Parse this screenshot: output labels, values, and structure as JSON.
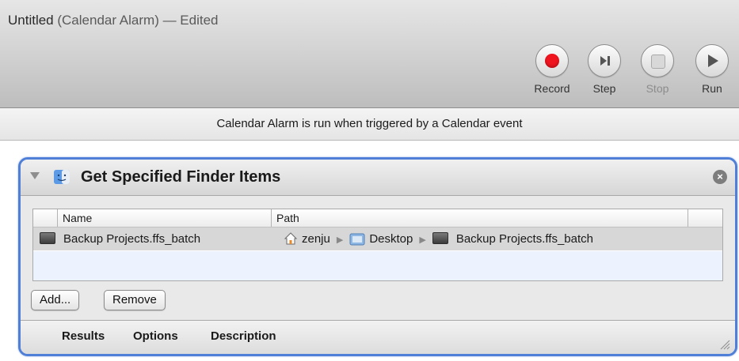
{
  "window": {
    "title_main": "Untitled",
    "title_rest": " (Calendar Alarm) — Edited"
  },
  "toolbar": {
    "record_label": "Record",
    "step_label": "Step",
    "stop_label": "Stop",
    "run_label": "Run"
  },
  "infobar": {
    "text": "Calendar Alarm is run when triggered by a Calendar event"
  },
  "action": {
    "title": "Get Specified Finder Items",
    "table": {
      "headers": [
        "Name",
        "Path"
      ],
      "rows": [
        {
          "name": "Backup Projects.ffs_batch",
          "path_home": "zenju",
          "path_folder": "Desktop",
          "path_file": "Backup Projects.ffs_batch"
        }
      ]
    },
    "add_label": "Add...",
    "remove_label": "Remove",
    "footer_tabs": [
      "Results",
      "Options",
      "Description"
    ]
  },
  "colors": {
    "accent": "#4f7fd7",
    "record": "#f0141e",
    "selected_row": "#d7d7d7"
  },
  "icons": [
    "record-icon",
    "step-icon",
    "stop-icon",
    "run-icon",
    "disclosure-triangle-icon",
    "finder-icon",
    "close-icon",
    "file-icon",
    "home-icon",
    "folder-icon",
    "resize-grip-icon"
  ]
}
